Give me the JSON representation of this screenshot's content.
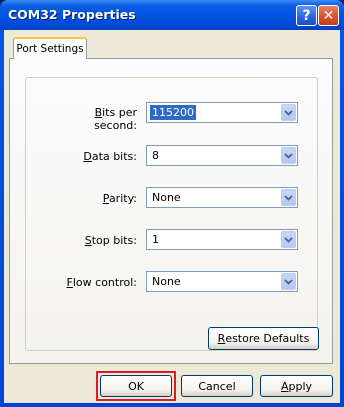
{
  "window": {
    "title": "COM32 Properties",
    "help_glyph": "?",
    "close_glyph": "✕"
  },
  "tab": {
    "label": "Port Settings"
  },
  "fields": [
    {
      "prefix": "",
      "accel": "B",
      "rest": "its per second:",
      "value": "115200",
      "selected": true
    },
    {
      "prefix": "",
      "accel": "D",
      "rest": "ata bits:",
      "value": "8",
      "selected": false
    },
    {
      "prefix": "",
      "accel": "P",
      "rest": "arity:",
      "value": "None",
      "selected": false
    },
    {
      "prefix": "",
      "accel": "S",
      "rest": "top bits:",
      "value": "1",
      "selected": false
    },
    {
      "prefix": "",
      "accel": "F",
      "rest": "low control:",
      "value": "None",
      "selected": false
    }
  ],
  "restore_button": {
    "accel": "R",
    "rest": "estore Defaults"
  },
  "buttons": {
    "ok": "OK",
    "cancel": "Cancel",
    "apply_accel": "A",
    "apply_rest": "pply"
  },
  "colors": {
    "title_bar": "#0053e1",
    "dialog_bg": "#ece9d8",
    "selection": "#316ac5",
    "highlight_box": "#e01c1c"
  }
}
